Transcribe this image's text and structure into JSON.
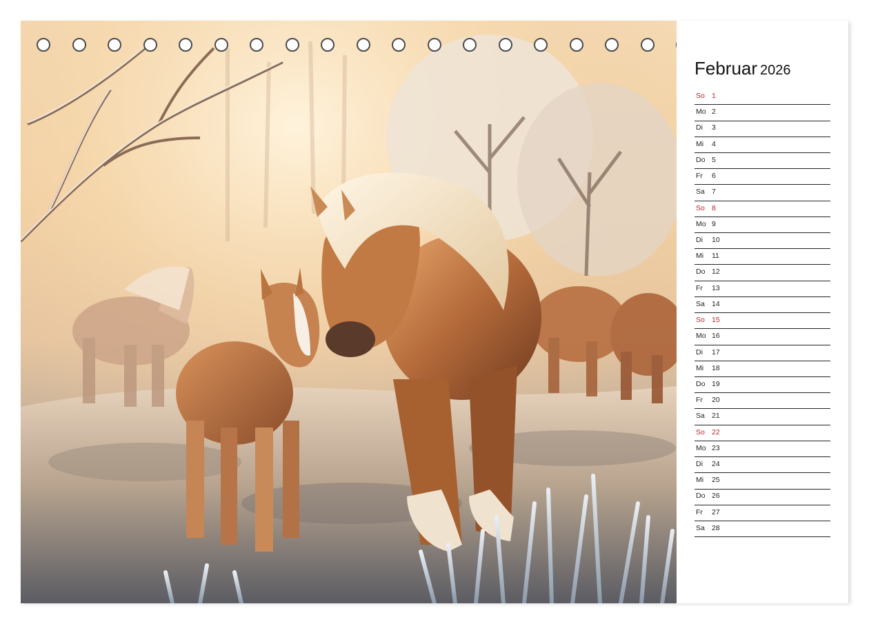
{
  "calendar": {
    "month": "Februar",
    "year": "2026",
    "ring_count": 23,
    "colors": {
      "sunday": "#b8242c",
      "text": "#222222",
      "rule": "#222222"
    },
    "days": [
      {
        "wd": "So",
        "d": "1",
        "sunday": true
      },
      {
        "wd": "Mo",
        "d": "2"
      },
      {
        "wd": "Di",
        "d": "3"
      },
      {
        "wd": "Mi",
        "d": "4"
      },
      {
        "wd": "Do",
        "d": "5"
      },
      {
        "wd": "Fr",
        "d": "6"
      },
      {
        "wd": "Sa",
        "d": "7"
      },
      {
        "wd": "So",
        "d": "8",
        "sunday": true
      },
      {
        "wd": "Mo",
        "d": "9"
      },
      {
        "wd": "Di",
        "d": "10"
      },
      {
        "wd": "Mi",
        "d": "11"
      },
      {
        "wd": "Do",
        "d": "12"
      },
      {
        "wd": "Fr",
        "d": "13"
      },
      {
        "wd": "Sa",
        "d": "14"
      },
      {
        "wd": "So",
        "d": "15",
        "sunday": true
      },
      {
        "wd": "Mo",
        "d": "16"
      },
      {
        "wd": "Di",
        "d": "17"
      },
      {
        "wd": "Mi",
        "d": "18"
      },
      {
        "wd": "Do",
        "d": "19"
      },
      {
        "wd": "Fr",
        "d": "20"
      },
      {
        "wd": "Sa",
        "d": "21"
      },
      {
        "wd": "So",
        "d": "22",
        "sunday": true
      },
      {
        "wd": "Mo",
        "d": "23"
      },
      {
        "wd": "Di",
        "d": "24"
      },
      {
        "wd": "Mi",
        "d": "25"
      },
      {
        "wd": "Do",
        "d": "26"
      },
      {
        "wd": "Fr",
        "d": "27"
      },
      {
        "wd": "Sa",
        "d": "28"
      }
    ]
  }
}
